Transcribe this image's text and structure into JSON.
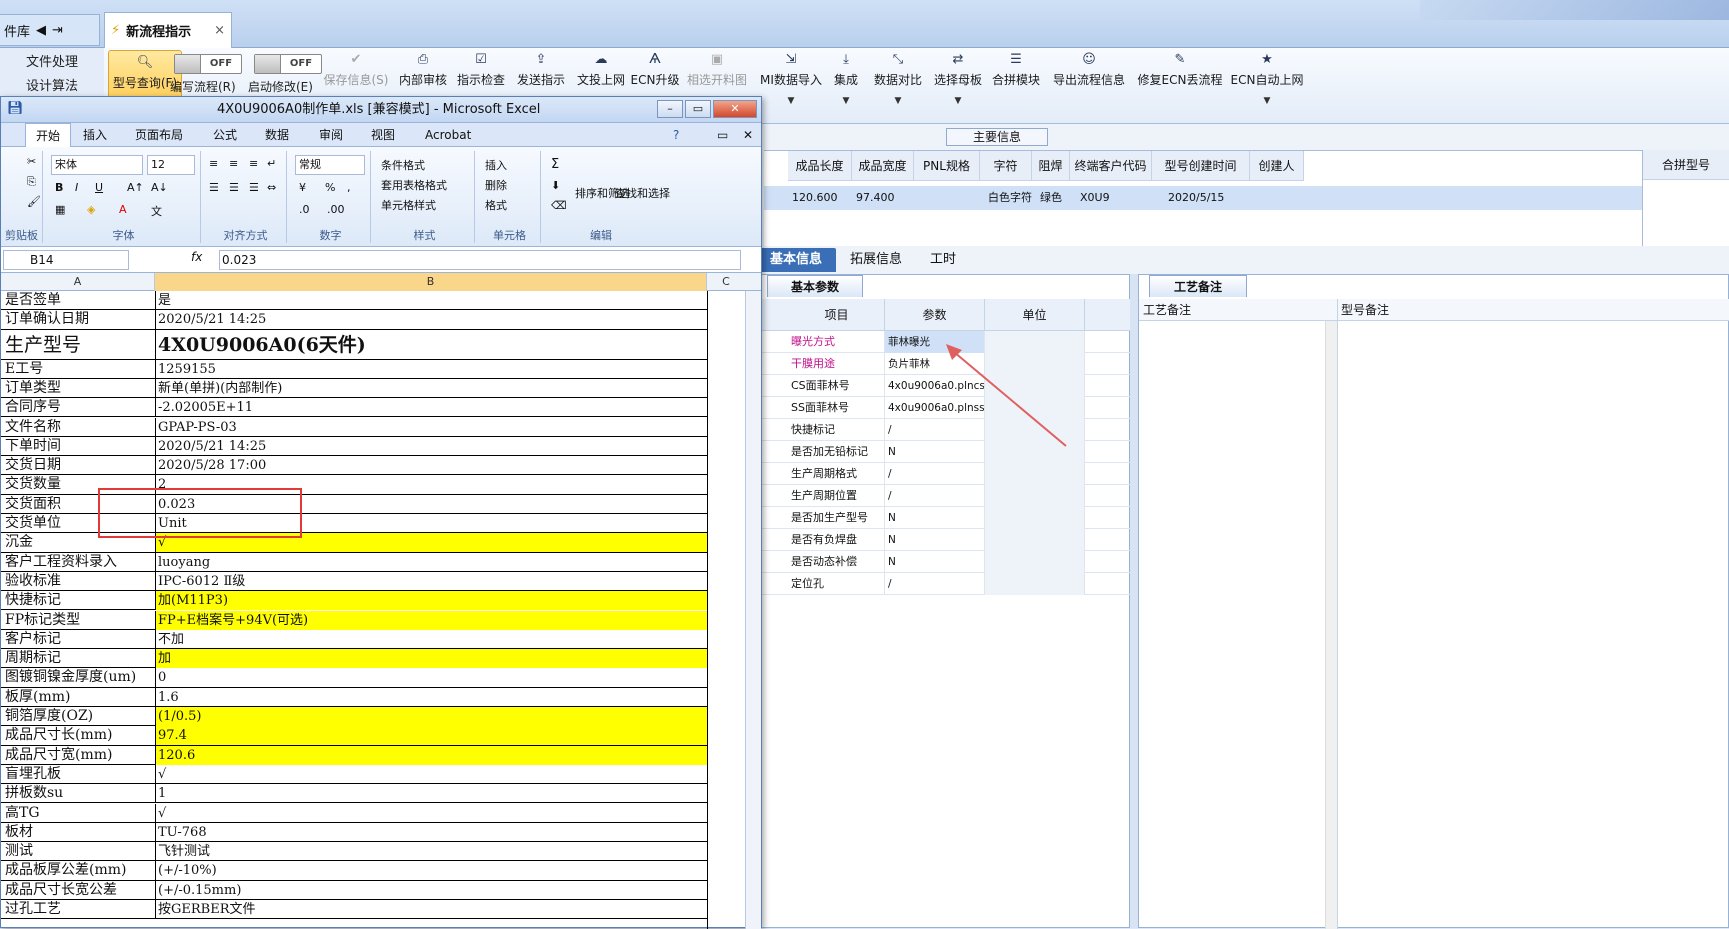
{
  "app": {
    "lib_tab": "件库",
    "flow_tab": "新流程指示",
    "left_nav": [
      "文件处理",
      "设计算法"
    ],
    "toolbar": {
      "model_query": "型号查询(F)",
      "edit_flow": "编写流程(R)",
      "auto_modify": "启动修改(E)",
      "toggle_off": "OFF",
      "buttons": [
        {
          "label": "保存信息(S)",
          "icon": "check-icon",
          "enabled": false
        },
        {
          "label": "内部审核",
          "icon": "printer-icon",
          "enabled": true
        },
        {
          "label": "指示检查",
          "icon": "checklist-icon",
          "enabled": true
        },
        {
          "label": "发送指示",
          "icon": "upload-icon",
          "enabled": true
        },
        {
          "label": "文投上网",
          "icon": "cloud-upload-icon",
          "enabled": true
        },
        {
          "label": "ECN升级",
          "icon": "ecn-icon",
          "enabled": true
        },
        {
          "label": "相选开料图",
          "icon": "image-icon",
          "enabled": false
        },
        {
          "label": "MI数据导入",
          "icon": "import-icon",
          "enabled": true
        },
        {
          "label": "集成",
          "icon": "download-icon",
          "enabled": true
        },
        {
          "label": "数据对比",
          "icon": "compare-icon",
          "enabled": true
        },
        {
          "label": "选择母板",
          "icon": "shuffle-icon",
          "enabled": true
        },
        {
          "label": "合拼模块",
          "icon": "list-icon",
          "enabled": true
        },
        {
          "label": "导出流程信息",
          "icon": "smile-icon",
          "enabled": true
        },
        {
          "label": "修复ECN丢流程",
          "icon": "wrench-icon",
          "enabled": true
        },
        {
          "label": "ECN自动上网",
          "icon": "star-icon",
          "enabled": true
        }
      ]
    },
    "main_info_label": "主要信息",
    "info_headers": [
      "成品长度",
      "成品宽度",
      "PNL规格",
      "字符",
      "阻焊",
      "终端客户代码",
      "型号创建时间",
      "创建人"
    ],
    "info_values": [
      "120.600",
      "97.400",
      "",
      "白色字符",
      "绿色",
      "X0U9",
      "2020/5/15",
      ""
    ],
    "merge_header": "合拼型号",
    "lower_tabs": [
      "基本信息",
      "拓展信息",
      "工时"
    ],
    "basic_tab": "基本参数",
    "basic_headers": [
      "项目",
      "参数",
      "单位"
    ],
    "basic_rows": [
      {
        "item": "曝光方式",
        "param": "菲林曝光"
      },
      {
        "item": "干膜用途",
        "param": "负片菲林"
      },
      {
        "item": "CS面菲林号",
        "param": "4x0u9006a0.plncs"
      },
      {
        "item": "SS面菲林号",
        "param": "4x0u9006a0.plnss"
      },
      {
        "item": "快捷标记",
        "param": "/"
      },
      {
        "item": "是否加无铅标记",
        "param": "N"
      },
      {
        "item": "生产周期格式",
        "param": "/"
      },
      {
        "item": "生产周期位置",
        "param": "/"
      },
      {
        "item": "是否加生产型号",
        "param": "N"
      },
      {
        "item": "是否有负焊盘",
        "param": "N"
      },
      {
        "item": "是否动态补偿",
        "param": "N"
      },
      {
        "item": "定位孔",
        "param": "/"
      }
    ],
    "craft_tab": "工艺备注",
    "craft_headers": [
      "工艺备注",
      "型号备注"
    ]
  },
  "excel": {
    "title": "4X0U9006A0制作单.xls  [兼容模式] - Microsoft Excel",
    "tabs": [
      "开始",
      "插入",
      "页面布局",
      "公式",
      "数据",
      "审阅",
      "视图",
      "Acrobat"
    ],
    "groups": [
      "剪贴板",
      "字体",
      "对齐方式",
      "数字",
      "样式",
      "单元格",
      "编辑"
    ],
    "font_name": "宋体",
    "font_size": "12",
    "number_format": "常规",
    "style_buttons": [
      "条件格式",
      "套用表格格式",
      "单元格样式"
    ],
    "cell_buttons": [
      "插入",
      "删除",
      "格式"
    ],
    "edit_buttons": [
      "排序和筛选",
      "查找和选择"
    ],
    "name_box": "B14",
    "formula": "0.023",
    "columns": [
      "A",
      "B",
      "C"
    ],
    "rows": [
      {
        "a": "是否签单",
        "b": "是"
      },
      {
        "a": "订单确认日期",
        "b": "2020/5/21 14:25"
      },
      {
        "a": "生产型号",
        "b": "4X0U9006A0(6天件)",
        "big": true
      },
      {
        "a": "E工号",
        "b": "1259155"
      },
      {
        "a": "订单类型",
        "b": "新单(单拼)(内部制作)"
      },
      {
        "a": "合同序号",
        "b": "-2.02005E+11"
      },
      {
        "a": "文件名称",
        "b": "GPAP-PS-03"
      },
      {
        "a": "下单时间",
        "b": "2020/5/21 14:25"
      },
      {
        "a": "交货日期",
        "b": "2020/5/28 17:00"
      },
      {
        "a": "交货数量",
        "b": "2"
      },
      {
        "a": "交货面积",
        "b": "0.023"
      },
      {
        "a": "交货单位",
        "b": "Unit"
      },
      {
        "a": "沉金",
        "b": "√",
        "yellow": true
      },
      {
        "a": "客户工程资料录入",
        "b": "luoyang"
      },
      {
        "a": "验收标准",
        "b": "IPC-6012 Ⅱ级"
      },
      {
        "a": "快捷标记",
        "b": "加(M11P3)",
        "yellow": true
      },
      {
        "a": "FP标记类型",
        "b": "FP+E档案号+94V(可选)",
        "yellow": true
      },
      {
        "a": "客户标记",
        "b": "不加"
      },
      {
        "a": "周期标记",
        "b": "加",
        "yellow": true
      },
      {
        "a": "图镀铜镍金厚度(um)",
        "b": "0"
      },
      {
        "a": "板厚(mm)",
        "b": "1.6"
      },
      {
        "a": "铜箔厚度(OZ)",
        "b": "(1/0.5)",
        "yellow": true
      },
      {
        "a": "成品尺寸长(mm)",
        "b": "97.4",
        "yellow": true
      },
      {
        "a": "成品尺寸宽(mm)",
        "b": "120.6",
        "yellow": true
      },
      {
        "a": "盲埋孔板",
        "b": "√"
      },
      {
        "a": "拼板数su",
        "b": "1"
      },
      {
        "a": "高TG",
        "b": "√"
      },
      {
        "a": "板材",
        "b": "TU-768"
      },
      {
        "a": "测试",
        "b": "飞针测试"
      },
      {
        "a": "成品板厚公差(mm)",
        "b": "(+/-10%)"
      },
      {
        "a": "成品尺寸长宽公差",
        "b": "(+/-0.15mm)"
      },
      {
        "a": "过孔工艺",
        "b": "按GERBER文件"
      }
    ]
  },
  "colors": {
    "accent": "#3a6fb8",
    "yellow": "#ffff00",
    "annotation": "#e03a3a"
  }
}
